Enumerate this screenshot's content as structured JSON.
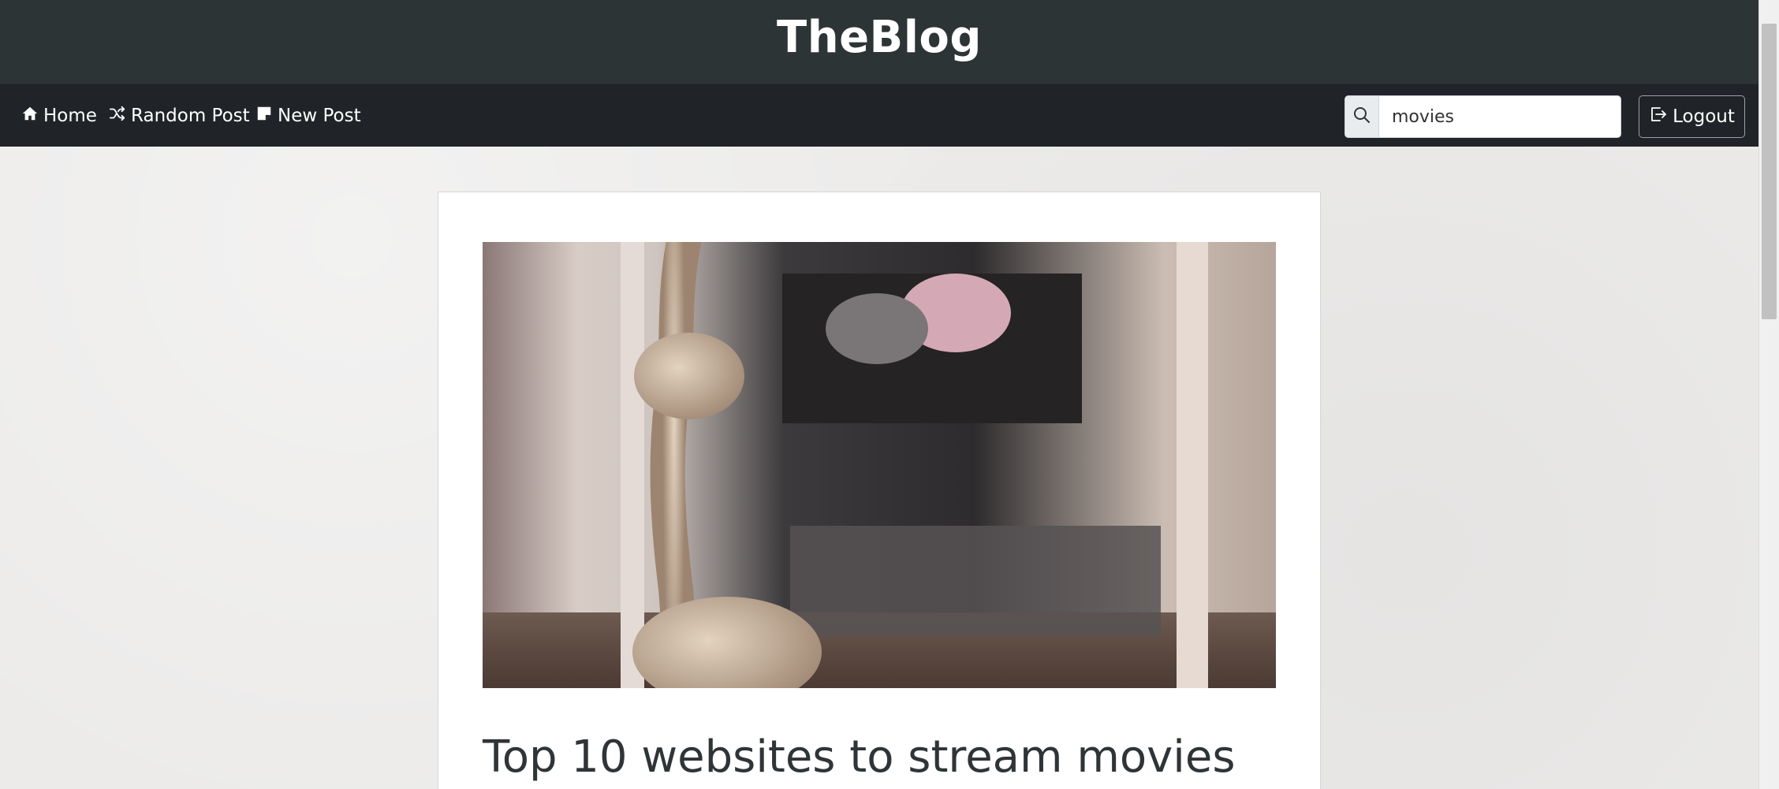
{
  "header": {
    "title": "TheBlog"
  },
  "nav": {
    "home_label": "Home",
    "random_label": "Random Post",
    "new_post_label": "New Post"
  },
  "search": {
    "value": "movies",
    "placeholder": ""
  },
  "logout_label": "Logout",
  "post": {
    "title": "Top 10 websites to stream movies",
    "image_alt": "rope knot photo"
  },
  "colors": {
    "header_bg": "#2c3435",
    "navbar_bg": "#202428",
    "page_bg": "#ecebea",
    "card_bg": "#ffffff"
  },
  "icons": [
    "house-icon",
    "shuffle-icon",
    "sticky-note-icon",
    "search-icon",
    "logout-icon"
  ]
}
